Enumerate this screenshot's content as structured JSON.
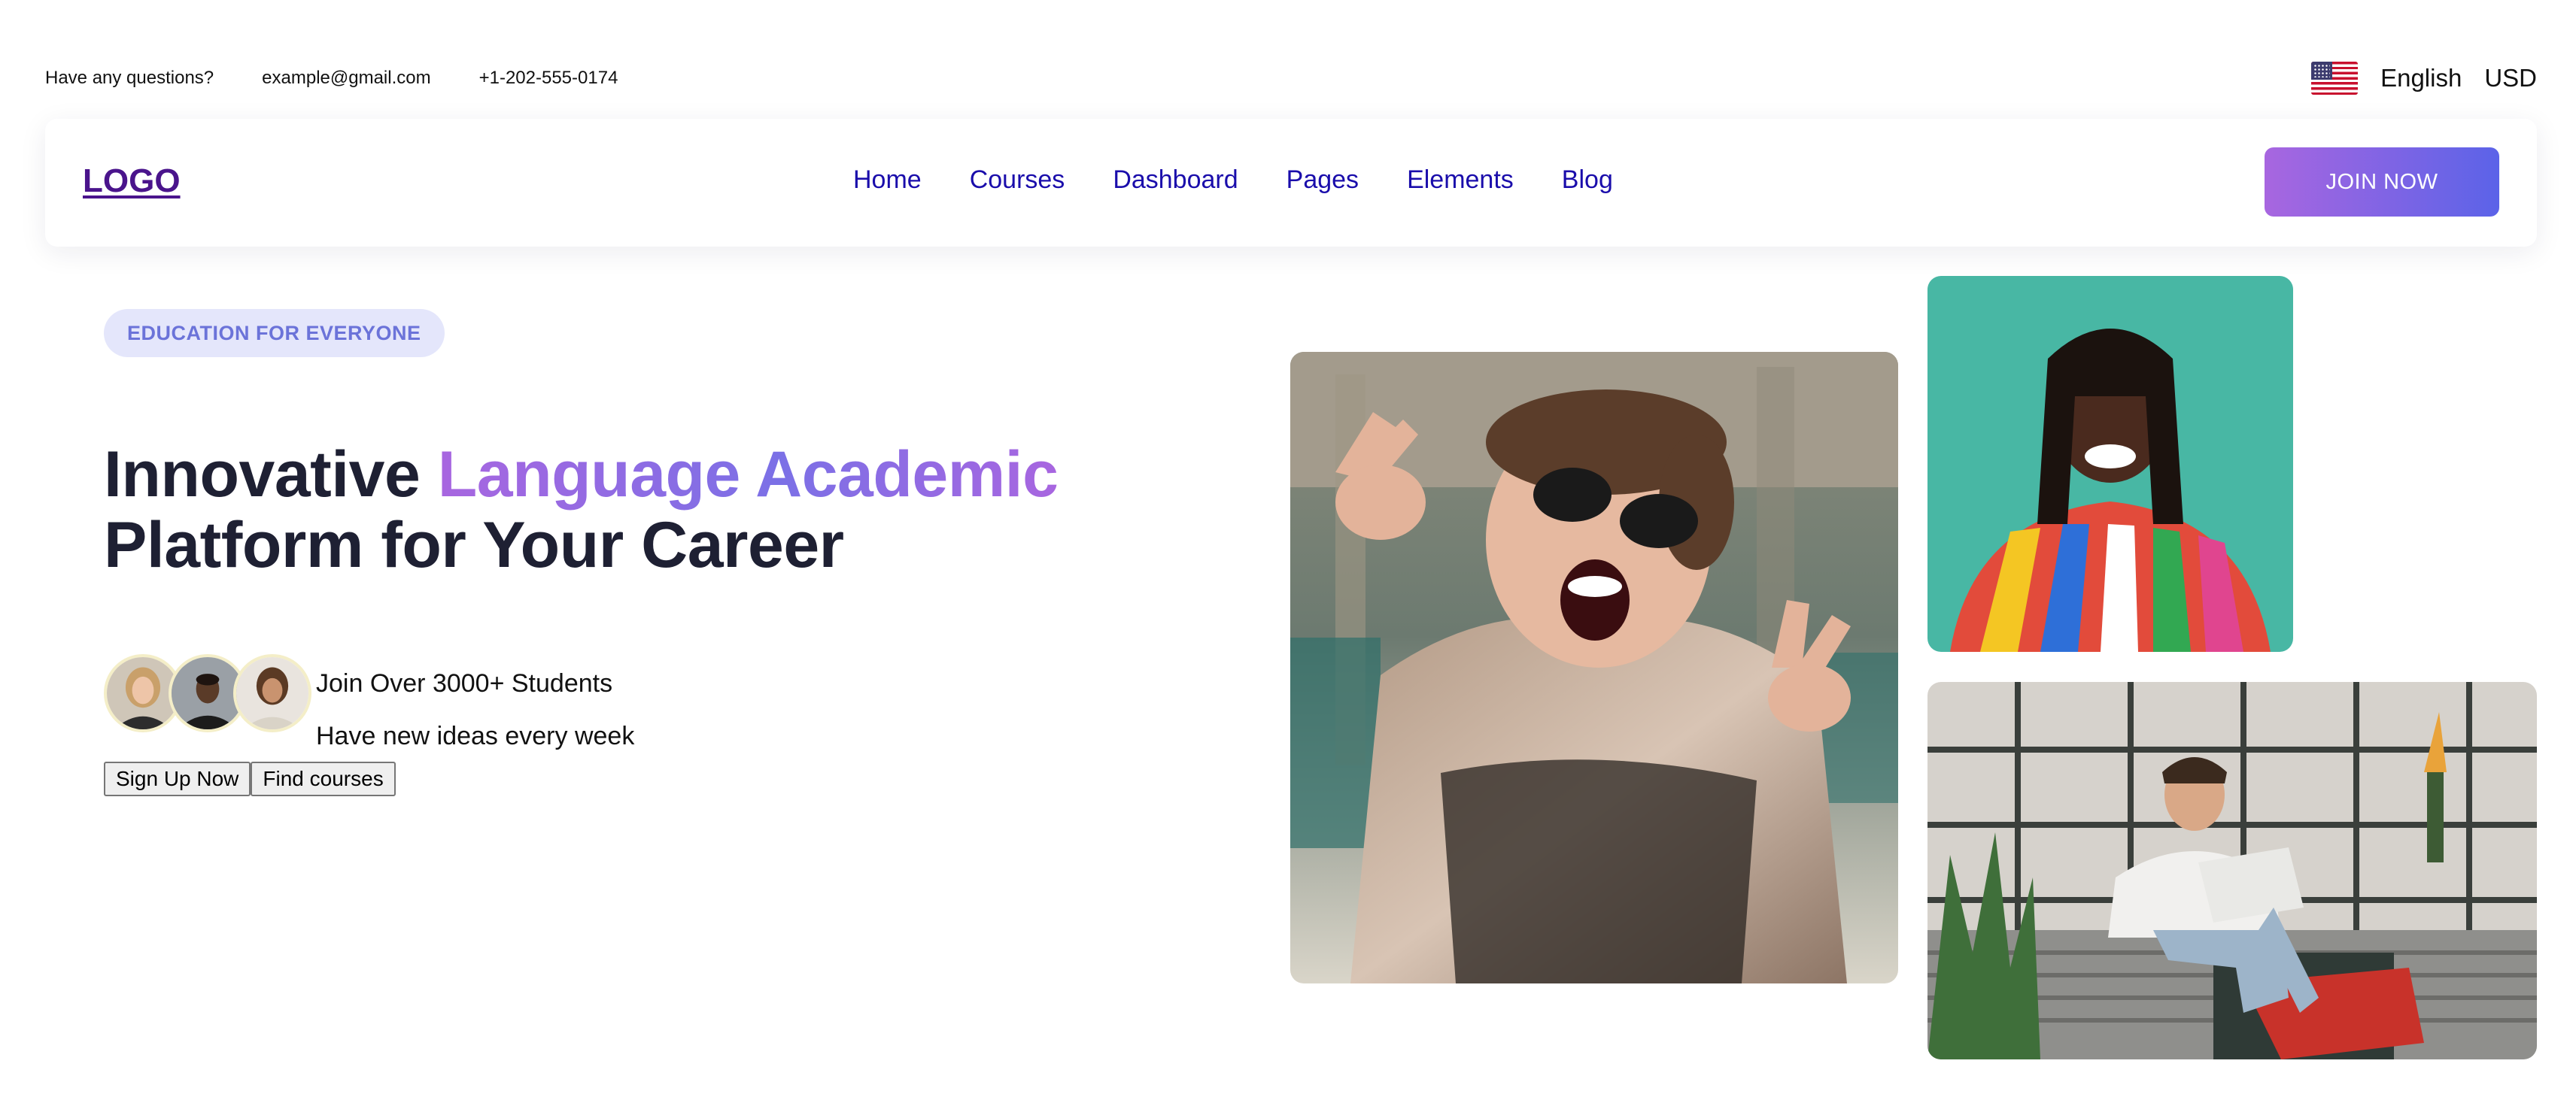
{
  "topbar": {
    "question": "Have any questions?",
    "email": "example@gmail.com",
    "phone": "+1-202-555-0174",
    "flag_icon": "us-flag-icon",
    "language": "English",
    "currency": "USD"
  },
  "navbar": {
    "logo": "LOGO",
    "links": [
      "Home",
      "Courses",
      "Dashboard",
      "Pages",
      "Elements",
      "Blog"
    ],
    "join_label": "JOIN NOW"
  },
  "hero": {
    "badge": "EDUCATION FOR EVERYONE",
    "headline_start": "Innovative ",
    "headline_accent": "Language Academic",
    "headline_end": " Platform for Your Career",
    "students_line1": "Join Over 3000+ Students",
    "students_line2": "Have new ideas every week",
    "signup_label": "Sign Up Now",
    "find_label": "Find courses"
  },
  "colors": {
    "accent_purple": "#a866e0",
    "accent_indigo": "#5b63e8",
    "badge_bg": "#e4e6fb",
    "badge_text": "#6b73d9",
    "logo": "#4a148c",
    "nav_link": "#1a0dab",
    "heading": "#1e2033"
  }
}
